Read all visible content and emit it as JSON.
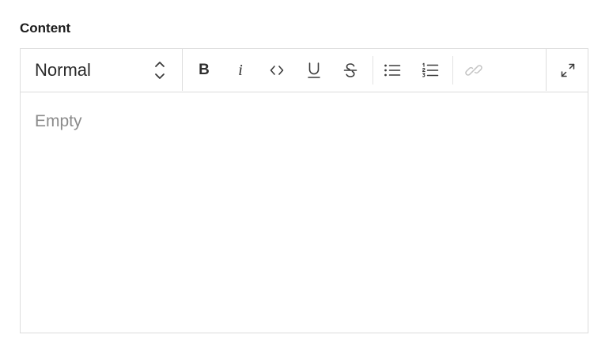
{
  "field": {
    "label": "Content"
  },
  "toolbar": {
    "block_type": {
      "selected": "Normal",
      "icon": "chevron-up-down-icon"
    },
    "bold_label": "B",
    "italic_label": "i",
    "buttons": [
      {
        "name": "bold",
        "icon": "bold-icon",
        "enabled": true
      },
      {
        "name": "italic",
        "icon": "italic-icon",
        "enabled": true
      },
      {
        "name": "code",
        "icon": "code-icon",
        "enabled": true
      },
      {
        "name": "underline",
        "icon": "underline-icon",
        "enabled": true
      },
      {
        "name": "strikethrough",
        "icon": "strikethrough-icon",
        "enabled": true
      },
      {
        "name": "bulleted-list",
        "icon": "bulleted-list-icon",
        "enabled": true
      },
      {
        "name": "numbered-list",
        "icon": "numbered-list-icon",
        "enabled": true
      },
      {
        "name": "link",
        "icon": "link-icon",
        "enabled": false
      },
      {
        "name": "expand",
        "icon": "expand-icon",
        "enabled": true
      }
    ]
  },
  "editor": {
    "placeholder": "Empty",
    "value": ""
  },
  "colors": {
    "border": "#dcdcdc",
    "icon": "#3a3a3a",
    "icon_disabled": "#c4c4c4",
    "placeholder": "#8b8b8b"
  }
}
